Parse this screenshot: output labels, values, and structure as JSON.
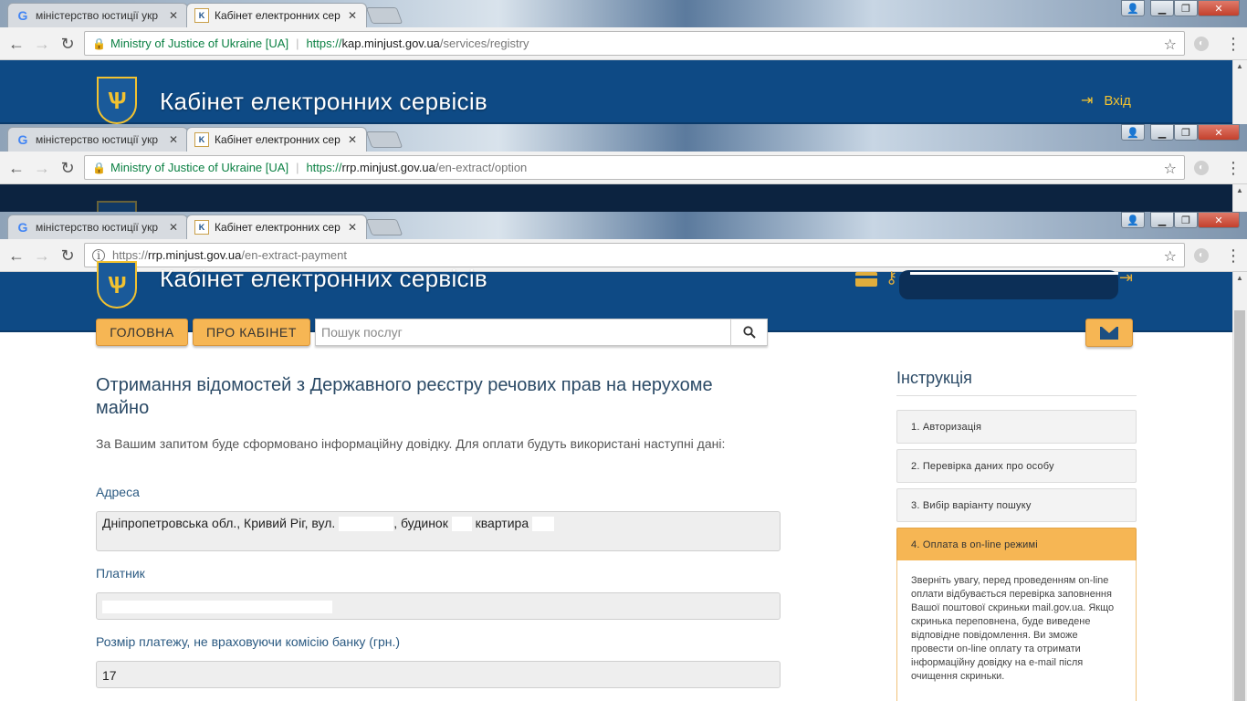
{
  "windows": [
    {
      "tabs": [
        {
          "title": "міністерство юстиції укр",
          "favicon": "google-icon"
        },
        {
          "title": "Кабінет електронних сер",
          "favicon": "kes-icon"
        }
      ],
      "secure_label": "Ministry of Justice of Ukraine [UA]",
      "url_scheme": "https://",
      "url_host": "kap.minjust.gov.ua",
      "url_path": "/services/registry"
    },
    {
      "tabs": [
        {
          "title": "міністерство юстиції укр",
          "favicon": "google-icon"
        },
        {
          "title": "Кабінет електронних сер",
          "favicon": "kes-icon"
        }
      ],
      "secure_label": "Ministry of Justice of Ukraine [UA]",
      "url_scheme": "https://",
      "url_host": "rrp.minjust.gov.ua",
      "url_path": "/en-extract/option"
    },
    {
      "tabs": [
        {
          "title": "міністерство юстиції укр",
          "favicon": "google-icon"
        },
        {
          "title": "Кабінет електронних сер",
          "favicon": "kes-icon"
        }
      ],
      "url_scheme": "https://",
      "url_host": "rrp.minjust.gov.ua",
      "url_path": "/en-extract-payment"
    }
  ],
  "site": {
    "title": "Кабінет електронних сервісів",
    "login_label": "Вхід",
    "emblem": "trident-emblem",
    "brand_color": "#0e4a85",
    "accent_color": "#f6b654"
  },
  "nav": {
    "home_label": "ГОЛОВНА",
    "about_label": "ПРО КАБІНЕТ",
    "search_placeholder": "Пошук послуг"
  },
  "main": {
    "heading": "Отримання відомостей з Державного реєстру речових прав на нерухоме майно",
    "intro": "За Вашим запитом буде сформовано інформаційну довідку. Для оплати будуть використані наступні дані:",
    "address_label": "Адреса",
    "address_part1": "Дніпропетровська обл., Кривий Ріг, вул.",
    "address_part2": ", будинок",
    "address_part3": "квартира",
    "payer_label": "Платник",
    "amount_label": "Розмір платежу, не враховуючи комісію банку (грн.)",
    "amount_value": "17"
  },
  "sidebar": {
    "heading": "Інструкція",
    "steps": [
      {
        "label": "1. Авторизація"
      },
      {
        "label": "2. Перевірка даних про особу"
      },
      {
        "label": "3. Вибір варіанту пошуку"
      },
      {
        "label": "4. Оплата в on-line режимі"
      }
    ],
    "active_step_text": "Зверніть увагу, перед проведенням on-line оплати відбувається перевірка заповнення Вашої поштової скриньки mail.gov.ua. Якщо скринька переповнена, буде виведене відповідне повідомлення. Ви зможе провести on-line оплату та отримати інформаційну довідку на e-mail після очищення скриньки."
  }
}
